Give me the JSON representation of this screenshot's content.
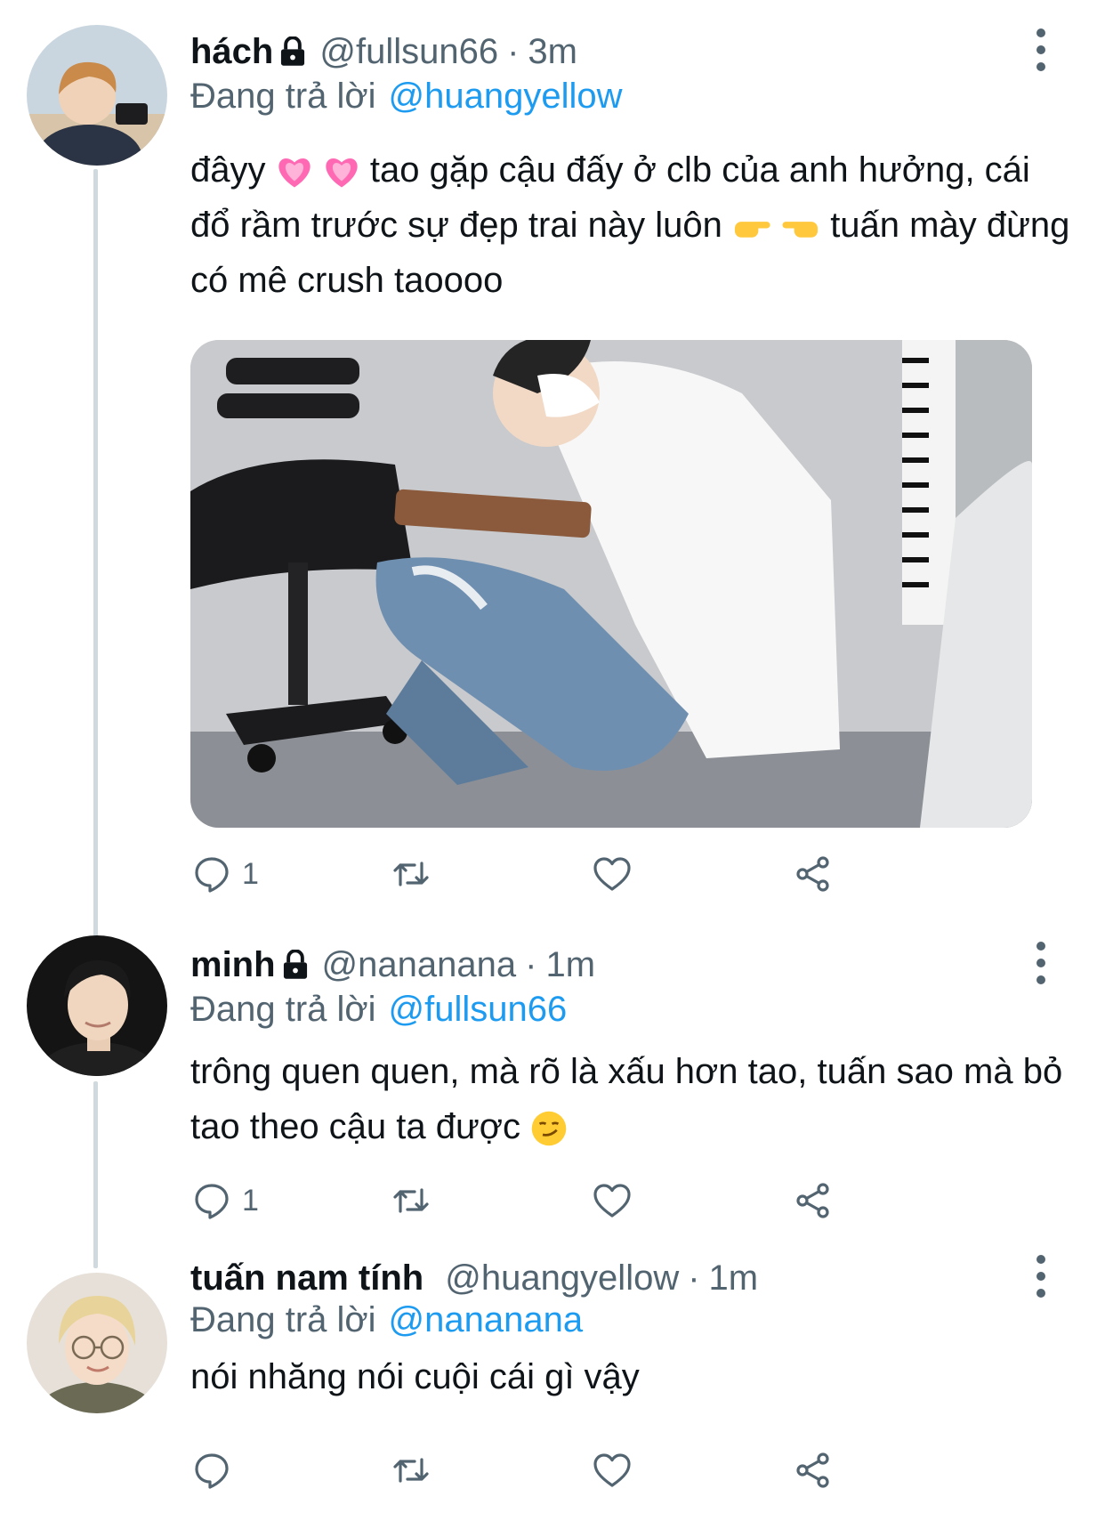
{
  "colors": {
    "accent": "#1d9bf0",
    "secondary": "#536471",
    "text": "#0f1419",
    "thread_line": "#cfd9de"
  },
  "tweets": [
    {
      "name": "hách",
      "protected": true,
      "handle": "@fullsun66",
      "separator": "·",
      "time": "3m",
      "reply_prefix": "Đang trả lời",
      "reply_mention": "@huangyellow",
      "text_a": "đâyy",
      "text_b": "tao gặp cậu đấy ở clb của anh hưởng, cái đổ rầm trước sự đẹp trai này luôn",
      "text_c": "tuấn mày đừng có mê crush taoooo",
      "emoji_a": [
        "pink-heart-emoji",
        "pink-heart-emoji"
      ],
      "emoji_b": [
        "pointing-right-emoji",
        "pointing-left-emoji"
      ],
      "has_media": true,
      "reply_count": "1",
      "icons": [
        "reply-icon",
        "retweet-icon",
        "like-icon",
        "share-icon",
        "lock-icon",
        "more-icon"
      ]
    },
    {
      "name": "minh",
      "protected": true,
      "handle": "@nananana",
      "separator": "·",
      "time": "1m",
      "reply_prefix": "Đang trả lời",
      "reply_mention": "@fullsun66",
      "text": "trông quen quen, mà rõ là xấu hơn tao, tuấn sao mà bỏ tao theo cậu ta được",
      "emoji": "smirking-face-emoji",
      "reply_count": "1"
    },
    {
      "name": "tuấn nam tính",
      "protected": false,
      "handle": "@huangyellow",
      "separator": "·",
      "time": "1m",
      "reply_prefix": "Đang trả lời",
      "reply_mention": "@nananana",
      "text": "nói nhăng nói cuội cái gì vậy",
      "reply_count": ""
    }
  ]
}
